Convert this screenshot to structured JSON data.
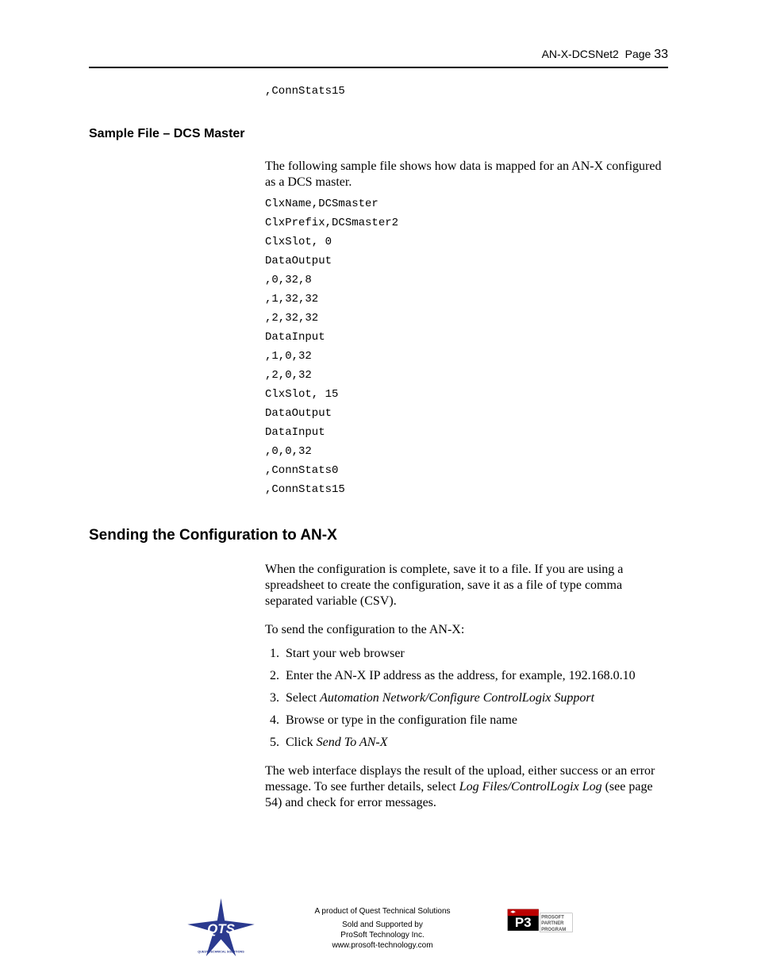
{
  "header": {
    "doc_title": "AN-X-DCSNet2",
    "page_label": "Page",
    "page_number": "33"
  },
  "top_code": ",ConnStats15",
  "section_sample": {
    "heading": "Sample File – DCS Master",
    "intro": "The following sample file shows how data is mapped for an AN-X configured as a DCS master.",
    "lines": [
      "ClxName,DCSmaster",
      "ClxPrefix,DCSmaster2",
      "ClxSlot, 0",
      "DataOutput",
      ",0,32,8",
      ",1,32,32",
      ",2,32,32",
      "DataInput",
      ",1,0,32",
      ",2,0,32",
      "ClxSlot, 15",
      "DataOutput",
      "DataInput",
      ",0,0,32",
      ",ConnStats0",
      ",ConnStats15"
    ]
  },
  "section_send": {
    "heading": "Sending the Configuration to AN-X",
    "p1": "When the configuration is complete, save it to a file.  If you are using a spreadsheet to create the configuration, save it as a file of type comma separated variable (CSV).",
    "p2": "To send the configuration to the AN-X:",
    "steps": [
      {
        "pre": "Start your web browser"
      },
      {
        "pre": "Enter the AN-X IP address as the address, for example, 192.168.0.10"
      },
      {
        "pre": "Select ",
        "em": "Automation Network/Configure ControlLogix Support"
      },
      {
        "pre": "Browse or type in the configuration file name"
      },
      {
        "pre": "Click ",
        "em": "Send To AN-X"
      }
    ],
    "p3_pre": "The web interface displays the result of the upload, either success or an error message.  To see further details, select ",
    "p3_em": "Log Files/ControlLogix Log",
    "p3_post": " (see page 54) and check for error messages."
  },
  "footer": {
    "line1": "A product of Quest Technical Solutions",
    "line2": "Sold and Supported by",
    "line3": "ProSoft Technology Inc.",
    "line4": "www.prosoft-technology.com",
    "qts_name": "QTS",
    "qts_sub": "QUEST TECHNICAL SOLUTIONS",
    "p3_name": "P3",
    "p3_sub1": "PROSOFT",
    "p3_sub2": "PARTNER",
    "p3_sub3": "PROGRAM"
  }
}
